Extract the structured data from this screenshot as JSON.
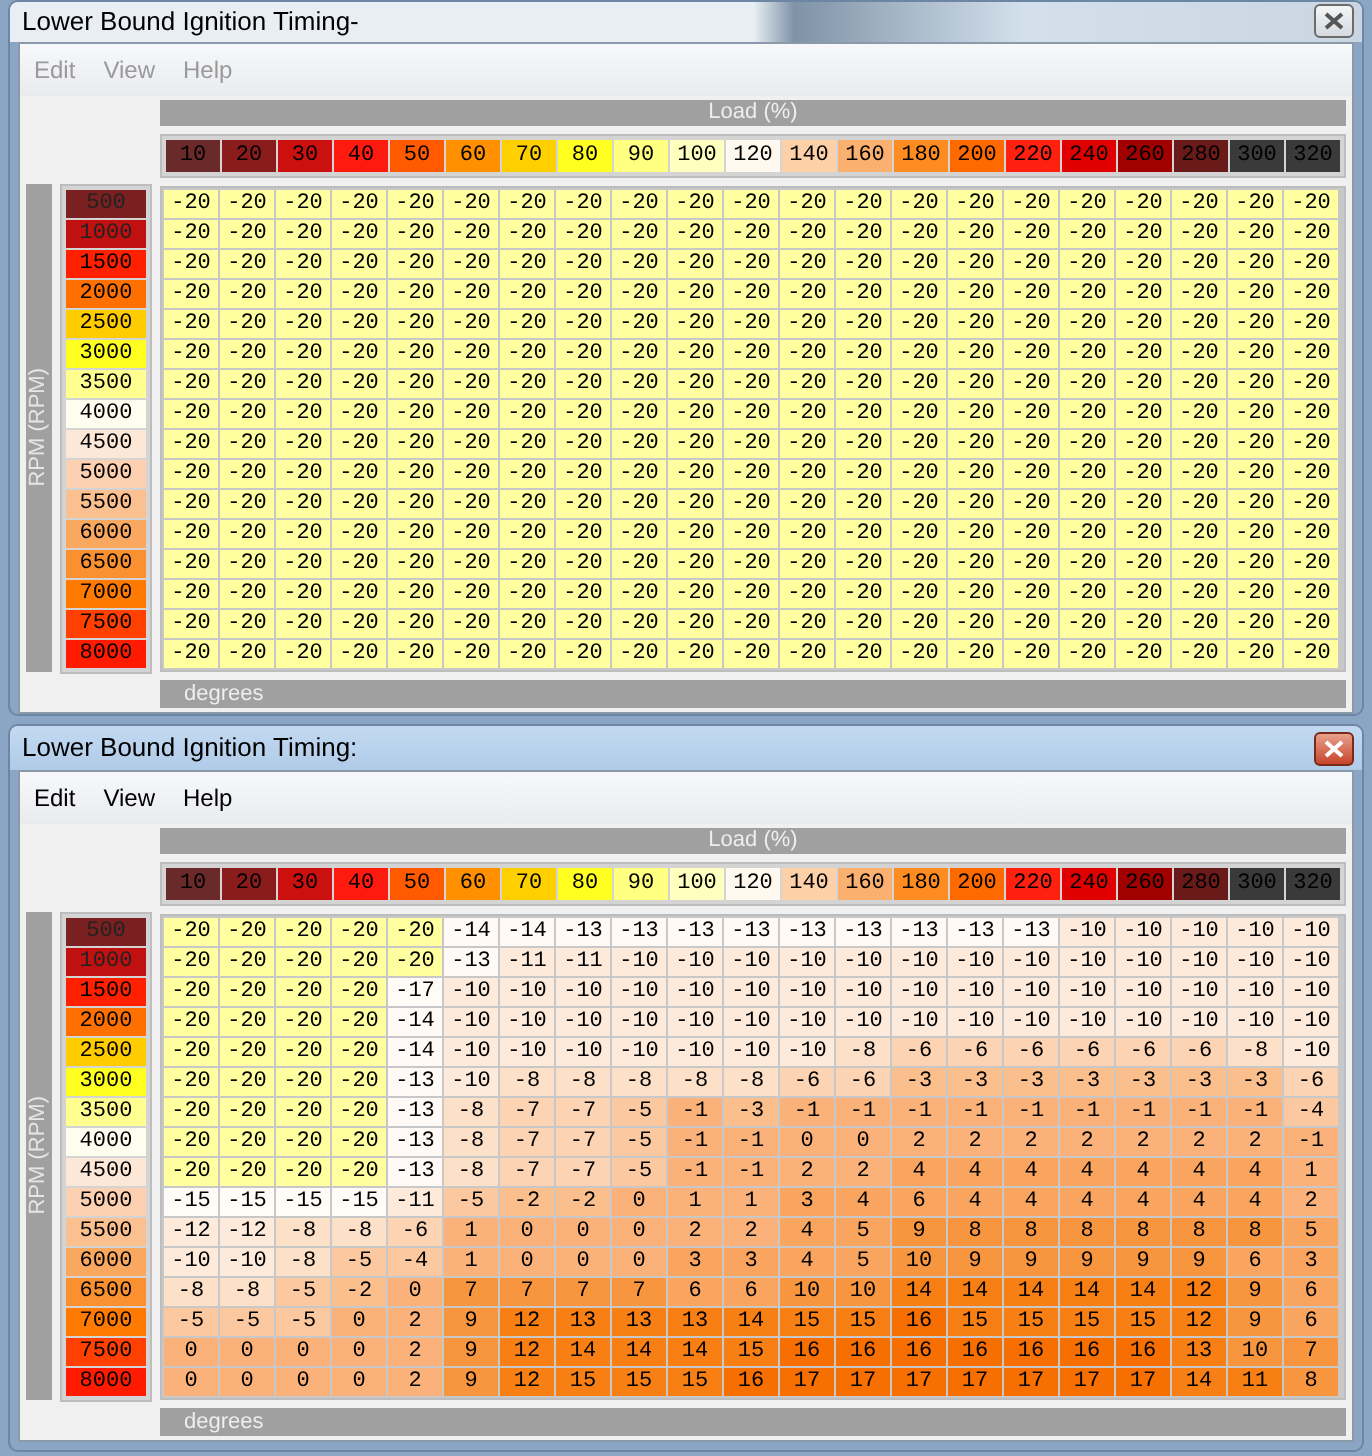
{
  "windows": [
    {
      "title": "Lower Bound Ignition Timing-",
      "active": false,
      "menu": [
        {
          "label": "Edit",
          "disabled": true
        },
        {
          "label": "View",
          "disabled": true
        },
        {
          "label": "Help",
          "disabled": true
        }
      ],
      "x_axis": {
        "title": "Load (%)",
        "labels": [
          {
            "text": "10",
            "color": "#6b2a2a"
          },
          {
            "text": "20",
            "color": "#8b1c1c"
          },
          {
            "text": "30",
            "color": "#cc1010"
          },
          {
            "text": "40",
            "color": "#ff1a10"
          },
          {
            "text": "50",
            "color": "#ff5a00"
          },
          {
            "text": "60",
            "color": "#ff9000"
          },
          {
            "text": "70",
            "color": "#ffd000"
          },
          {
            "text": "80",
            "color": "#ffff20"
          },
          {
            "text": "90",
            "color": "#ffff80"
          },
          {
            "text": "100",
            "color": "#ffffc0"
          },
          {
            "text": "120",
            "color": "#fff8ef"
          },
          {
            "text": "140",
            "color": "#fdd0a8"
          },
          {
            "text": "160",
            "color": "#fcb070"
          },
          {
            "text": "180",
            "color": "#ff8c20"
          },
          {
            "text": "200",
            "color": "#ff6a00"
          },
          {
            "text": "220",
            "color": "#ff2010"
          },
          {
            "text": "240",
            "color": "#e00000"
          },
          {
            "text": "260",
            "color": "#a00000"
          },
          {
            "text": "280",
            "color": "#6b1a1a"
          },
          {
            "text": "300",
            "color": "#3a3a3a"
          },
          {
            "text": "320",
            "color": "#3a3a3a"
          }
        ]
      },
      "y_axis": {
        "title": "RPM (RPM)",
        "labels": [
          {
            "text": "500",
            "color": "#7a2020"
          },
          {
            "text": "1000",
            "color": "#c01010"
          },
          {
            "text": "1500",
            "color": "#ff2000"
          },
          {
            "text": "2000",
            "color": "#ff7000"
          },
          {
            "text": "2500",
            "color": "#ffcc00"
          },
          {
            "text": "3000",
            "color": "#ffff20"
          },
          {
            "text": "3500",
            "color": "#ffff90"
          },
          {
            "text": "4000",
            "color": "#fffdf0"
          },
          {
            "text": "4500",
            "color": "#fde8d8"
          },
          {
            "text": "5000",
            "color": "#fcd0b0"
          },
          {
            "text": "5500",
            "color": "#fbc090"
          },
          {
            "text": "6000",
            "color": "#faa860"
          },
          {
            "text": "6500",
            "color": "#fa9030"
          },
          {
            "text": "7000",
            "color": "#ff7a00"
          },
          {
            "text": "7500",
            "color": "#ff4000"
          },
          {
            "text": "8000",
            "color": "#ff1a00"
          }
        ]
      },
      "rows": [
        [
          "-20",
          "-20",
          "-20",
          "-20",
          "-20",
          "-20",
          "-20",
          "-20",
          "-20",
          "-20",
          "-20",
          "-20",
          "-20",
          "-20",
          "-20",
          "-20",
          "-20",
          "-20",
          "-20",
          "-20",
          "-20"
        ],
        [
          "-20",
          "-20",
          "-20",
          "-20",
          "-20",
          "-20",
          "-20",
          "-20",
          "-20",
          "-20",
          "-20",
          "-20",
          "-20",
          "-20",
          "-20",
          "-20",
          "-20",
          "-20",
          "-20",
          "-20",
          "-20"
        ],
        [
          "-20",
          "-20",
          "-20",
          "-20",
          "-20",
          "-20",
          "-20",
          "-20",
          "-20",
          "-20",
          "-20",
          "-20",
          "-20",
          "-20",
          "-20",
          "-20",
          "-20",
          "-20",
          "-20",
          "-20",
          "-20"
        ],
        [
          "-20",
          "-20",
          "-20",
          "-20",
          "-20",
          "-20",
          "-20",
          "-20",
          "-20",
          "-20",
          "-20",
          "-20",
          "-20",
          "-20",
          "-20",
          "-20",
          "-20",
          "-20",
          "-20",
          "-20",
          "-20"
        ],
        [
          "-20",
          "-20",
          "-20",
          "-20",
          "-20",
          "-20",
          "-20",
          "-20",
          "-20",
          "-20",
          "-20",
          "-20",
          "-20",
          "-20",
          "-20",
          "-20",
          "-20",
          "-20",
          "-20",
          "-20",
          "-20"
        ],
        [
          "-20",
          "-20",
          "-20",
          "-20",
          "-20",
          "-20",
          "-20",
          "-20",
          "-20",
          "-20",
          "-20",
          "-20",
          "-20",
          "-20",
          "-20",
          "-20",
          "-20",
          "-20",
          "-20",
          "-20",
          "-20"
        ],
        [
          "-20",
          "-20",
          "-20",
          "-20",
          "-20",
          "-20",
          "-20",
          "-20",
          "-20",
          "-20",
          "-20",
          "-20",
          "-20",
          "-20",
          "-20",
          "-20",
          "-20",
          "-20",
          "-20",
          "-20",
          "-20"
        ],
        [
          "-20",
          "-20",
          "-20",
          "-20",
          "-20",
          "-20",
          "-20",
          "-20",
          "-20",
          "-20",
          "-20",
          "-20",
          "-20",
          "-20",
          "-20",
          "-20",
          "-20",
          "-20",
          "-20",
          "-20",
          "-20"
        ],
        [
          "-20",
          "-20",
          "-20",
          "-20",
          "-20",
          "-20",
          "-20",
          "-20",
          "-20",
          "-20",
          "-20",
          "-20",
          "-20",
          "-20",
          "-20",
          "-20",
          "-20",
          "-20",
          "-20",
          "-20",
          "-20"
        ],
        [
          "-20",
          "-20",
          "-20",
          "-20",
          "-20",
          "-20",
          "-20",
          "-20",
          "-20",
          "-20",
          "-20",
          "-20",
          "-20",
          "-20",
          "-20",
          "-20",
          "-20",
          "-20",
          "-20",
          "-20",
          "-20"
        ],
        [
          "-20",
          "-20",
          "-20",
          "-20",
          "-20",
          "-20",
          "-20",
          "-20",
          "-20",
          "-20",
          "-20",
          "-20",
          "-20",
          "-20",
          "-20",
          "-20",
          "-20",
          "-20",
          "-20",
          "-20",
          "-20"
        ],
        [
          "-20",
          "-20",
          "-20",
          "-20",
          "-20",
          "-20",
          "-20",
          "-20",
          "-20",
          "-20",
          "-20",
          "-20",
          "-20",
          "-20",
          "-20",
          "-20",
          "-20",
          "-20",
          "-20",
          "-20",
          "-20"
        ],
        [
          "-20",
          "-20",
          "-20",
          "-20",
          "-20",
          "-20",
          "-20",
          "-20",
          "-20",
          "-20",
          "-20",
          "-20",
          "-20",
          "-20",
          "-20",
          "-20",
          "-20",
          "-20",
          "-20",
          "-20",
          "-20"
        ],
        [
          "-20",
          "-20",
          "-20",
          "-20",
          "-20",
          "-20",
          "-20",
          "-20",
          "-20",
          "-20",
          "-20",
          "-20",
          "-20",
          "-20",
          "-20",
          "-20",
          "-20",
          "-20",
          "-20",
          "-20",
          "-20"
        ],
        [
          "-20",
          "-20",
          "-20",
          "-20",
          "-20",
          "-20",
          "-20",
          "-20",
          "-20",
          "-20",
          "-20",
          "-20",
          "-20",
          "-20",
          "-20",
          "-20",
          "-20",
          "-20",
          "-20",
          "-20",
          "-20"
        ],
        [
          "-20",
          "-20",
          "-20",
          "-20",
          "-20",
          "-20",
          "-20",
          "-20",
          "-20",
          "-20",
          "-20",
          "-20",
          "-20",
          "-20",
          "-20",
          "-20",
          "-20",
          "-20",
          "-20",
          "-20",
          "-20"
        ]
      ],
      "unit": "degrees"
    },
    {
      "title": "Lower Bound Ignition Timing:",
      "active": true,
      "menu": [
        {
          "label": "Edit",
          "disabled": false
        },
        {
          "label": "View",
          "disabled": false
        },
        {
          "label": "Help",
          "disabled": false
        }
      ],
      "x_axis": {
        "title": "Load (%)",
        "labels": [
          {
            "text": "10",
            "color": "#6b2a2a"
          },
          {
            "text": "20",
            "color": "#8b1c1c"
          },
          {
            "text": "30",
            "color": "#cc1010"
          },
          {
            "text": "40",
            "color": "#ff1a10"
          },
          {
            "text": "50",
            "color": "#ff5a00"
          },
          {
            "text": "60",
            "color": "#ff9000"
          },
          {
            "text": "70",
            "color": "#ffd000"
          },
          {
            "text": "80",
            "color": "#ffff20"
          },
          {
            "text": "90",
            "color": "#ffff80"
          },
          {
            "text": "100",
            "color": "#ffffc0"
          },
          {
            "text": "120",
            "color": "#fff8ef"
          },
          {
            "text": "140",
            "color": "#fdd0a8"
          },
          {
            "text": "160",
            "color": "#fcb070"
          },
          {
            "text": "180",
            "color": "#ff8c20"
          },
          {
            "text": "200",
            "color": "#ff6a00"
          },
          {
            "text": "220",
            "color": "#ff2010"
          },
          {
            "text": "240",
            "color": "#e00000"
          },
          {
            "text": "260",
            "color": "#a00000"
          },
          {
            "text": "280",
            "color": "#6b1a1a"
          },
          {
            "text": "300",
            "color": "#3a3a3a"
          },
          {
            "text": "320",
            "color": "#3a3a3a"
          }
        ]
      },
      "y_axis": {
        "title": "RPM (RPM)",
        "labels": [
          {
            "text": "500",
            "color": "#7a2020"
          },
          {
            "text": "1000",
            "color": "#c01010"
          },
          {
            "text": "1500",
            "color": "#ff2000"
          },
          {
            "text": "2000",
            "color": "#ff7000"
          },
          {
            "text": "2500",
            "color": "#ffcc00"
          },
          {
            "text": "3000",
            "color": "#ffff20"
          },
          {
            "text": "3500",
            "color": "#ffff90"
          },
          {
            "text": "4000",
            "color": "#fffdf0"
          },
          {
            "text": "4500",
            "color": "#fde8d8"
          },
          {
            "text": "5000",
            "color": "#fcd0b0"
          },
          {
            "text": "5500",
            "color": "#fbc090"
          },
          {
            "text": "6000",
            "color": "#faa860"
          },
          {
            "text": "6500",
            "color": "#fa9030"
          },
          {
            "text": "7000",
            "color": "#ff7a00"
          },
          {
            "text": "7500",
            "color": "#ff4000"
          },
          {
            "text": "8000",
            "color": "#ff1a00"
          }
        ]
      },
      "rows": [
        [
          "-20",
          "-20",
          "-20",
          "-20",
          "-20",
          "-14",
          "-14",
          "-13",
          "-13",
          "-13",
          "-13",
          "-13",
          "-13",
          "-13",
          "-13",
          "-13",
          "-10",
          "-10",
          "-10",
          "-10",
          "-10"
        ],
        [
          "-20",
          "-20",
          "-20",
          "-20",
          "-20",
          "-13",
          "-11",
          "-11",
          "-10",
          "-10",
          "-10",
          "-10",
          "-10",
          "-10",
          "-10",
          "-10",
          "-10",
          "-10",
          "-10",
          "-10",
          "-10"
        ],
        [
          "-20",
          "-20",
          "-20",
          "-20",
          "-17",
          "-10",
          "-10",
          "-10",
          "-10",
          "-10",
          "-10",
          "-10",
          "-10",
          "-10",
          "-10",
          "-10",
          "-10",
          "-10",
          "-10",
          "-10",
          "-10"
        ],
        [
          "-20",
          "-20",
          "-20",
          "-20",
          "-14",
          "-10",
          "-10",
          "-10",
          "-10",
          "-10",
          "-10",
          "-10",
          "-10",
          "-10",
          "-10",
          "-10",
          "-10",
          "-10",
          "-10",
          "-10",
          "-10"
        ],
        [
          "-20",
          "-20",
          "-20",
          "-20",
          "-14",
          "-10",
          "-10",
          "-10",
          "-10",
          "-10",
          "-10",
          "-10",
          "-8",
          "-6",
          "-6",
          "-6",
          "-6",
          "-6",
          "-6",
          "-8",
          "-10"
        ],
        [
          "-20",
          "-20",
          "-20",
          "-20",
          "-13",
          "-10",
          "-8",
          "-8",
          "-8",
          "-8",
          "-8",
          "-6",
          "-6",
          "-3",
          "-3",
          "-3",
          "-3",
          "-3",
          "-3",
          "-3",
          "-6"
        ],
        [
          "-20",
          "-20",
          "-20",
          "-20",
          "-13",
          "-8",
          "-7",
          "-7",
          "-5",
          "-1",
          "-3",
          "-1",
          "-1",
          "-1",
          "-1",
          "-1",
          "-1",
          "-1",
          "-1",
          "-1",
          "-4"
        ],
        [
          "-20",
          "-20",
          "-20",
          "-20",
          "-13",
          "-8",
          "-7",
          "-7",
          "-5",
          "-1",
          "-1",
          "0",
          "0",
          "2",
          "2",
          "2",
          "2",
          "2",
          "2",
          "2",
          "-1"
        ],
        [
          "-20",
          "-20",
          "-20",
          "-20",
          "-13",
          "-8",
          "-7",
          "-7",
          "-5",
          "-1",
          "-1",
          "2",
          "2",
          "4",
          "4",
          "4",
          "4",
          "4",
          "4",
          "4",
          "1"
        ],
        [
          "-15",
          "-15",
          "-15",
          "-15",
          "-11",
          "-5",
          "-2",
          "-2",
          "0",
          "1",
          "1",
          "3",
          "4",
          "6",
          "4",
          "4",
          "4",
          "4",
          "4",
          "4",
          "2"
        ],
        [
          "-12",
          "-12",
          "-8",
          "-8",
          "-6",
          "1",
          "0",
          "0",
          "0",
          "2",
          "2",
          "4",
          "5",
          "9",
          "8",
          "8",
          "8",
          "8",
          "8",
          "8",
          "5"
        ],
        [
          "-10",
          "-10",
          "-8",
          "-5",
          "-4",
          "1",
          "0",
          "0",
          "0",
          "3",
          "3",
          "4",
          "5",
          "10",
          "9",
          "9",
          "9",
          "9",
          "9",
          "6",
          "3"
        ],
        [
          "-8",
          "-8",
          "-5",
          "-2",
          "0",
          "7",
          "7",
          "7",
          "7",
          "6",
          "6",
          "10",
          "10",
          "14",
          "14",
          "14",
          "14",
          "14",
          "12",
          "9",
          "6"
        ],
        [
          "-5",
          "-5",
          "-5",
          "0",
          "2",
          "9",
          "12",
          "13",
          "13",
          "13",
          "14",
          "15",
          "15",
          "16",
          "15",
          "15",
          "15",
          "15",
          "12",
          "9",
          "6"
        ],
        [
          "0",
          "0",
          "0",
          "0",
          "2",
          "9",
          "12",
          "14",
          "14",
          "14",
          "15",
          "16",
          "16",
          "16",
          "16",
          "16",
          "16",
          "16",
          "13",
          "10",
          "7"
        ],
        [
          "0",
          "0",
          "0",
          "0",
          "2",
          "9",
          "12",
          "15",
          "15",
          "15",
          "16",
          "17",
          "17",
          "17",
          "17",
          "17",
          "17",
          "17",
          "14",
          "11",
          "8"
        ]
      ],
      "unit": "degrees"
    }
  ]
}
